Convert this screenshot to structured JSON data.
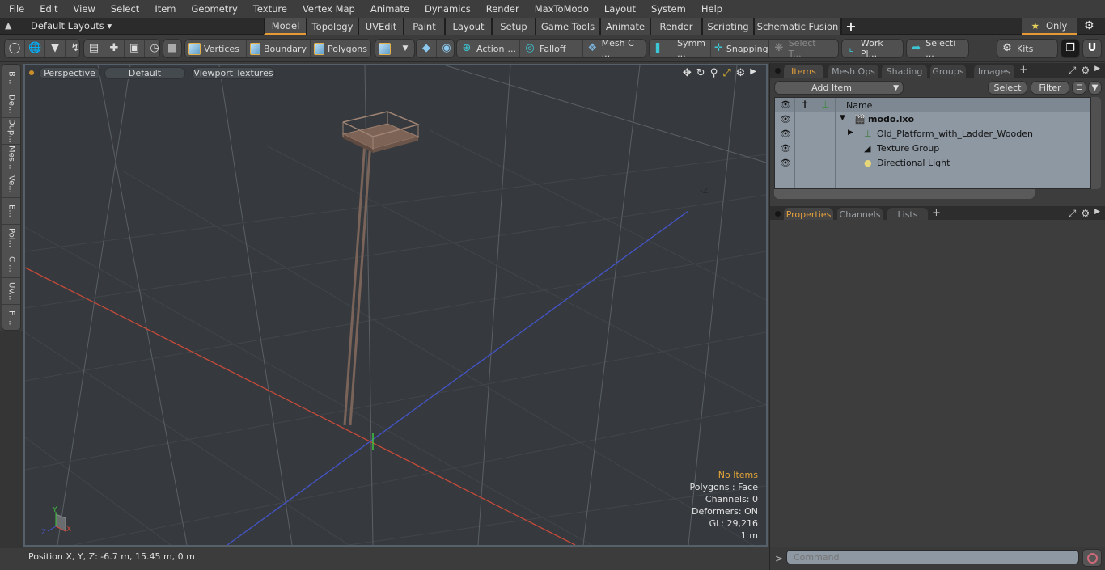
{
  "menu": [
    "File",
    "Edit",
    "View",
    "Select",
    "Item",
    "Geometry",
    "Texture",
    "Vertex Map",
    "Animate",
    "Dynamics",
    "Render",
    "MaxToModo",
    "Layout",
    "System",
    "Help"
  ],
  "layoutbar": {
    "layouts_label": "Default Layouts",
    "tabs": [
      {
        "label": "Model",
        "active": true
      },
      {
        "label": "Topology"
      },
      {
        "label": "UVEdit"
      },
      {
        "label": "Paint"
      },
      {
        "label": "Layout"
      },
      {
        "label": "Setup"
      },
      {
        "label": "Game Tools"
      },
      {
        "label": "Animate"
      },
      {
        "label": "Render"
      },
      {
        "label": "Scripting"
      },
      {
        "label": "Schematic Fusion"
      }
    ],
    "only_label": "Only"
  },
  "toolbar": {
    "vertices": "Vertices",
    "boundary": "Boundary",
    "polygons": "Polygons",
    "action": "Action",
    "falloff": "Falloff",
    "mesh_c": "Mesh C ...",
    "symm": "Symm ...",
    "snapping": "Snapping",
    "select_t": "Select T...",
    "work_pl": "Work Pl...",
    "selecti": "Selecti ...",
    "kits": "Kits",
    "ellipsis": "..."
  },
  "left_tools": [
    "B...",
    "De...",
    "Dup...",
    "Mes...",
    "Ve...",
    "E...",
    "Pol...",
    "C ...",
    "UV...",
    "F ..."
  ],
  "viewport": {
    "view_mode": "Perspective",
    "shading": "Default",
    "textures": "Viewport Textures",
    "axis_label": "-Z",
    "info": {
      "selection": "No Items",
      "polygons": "Polygons : Face",
      "channels": "Channels: 0",
      "deformers": "Deformers: ON",
      "gl": "GL: 29,216",
      "scale": "1 m"
    },
    "gizmo": {
      "x": "X",
      "y": "Y",
      "z": "Z"
    }
  },
  "status": {
    "position": "Position X, Y, Z:   -6.7 m, 15.45 m, 0 m"
  },
  "items_panel": {
    "tabs": [
      {
        "label": "Items",
        "active": true
      },
      {
        "label": "Mesh Ops"
      },
      {
        "label": "Shading"
      },
      {
        "label": "Groups"
      },
      {
        "label": "Images"
      }
    ],
    "add_item": "Add Item",
    "select": "Select",
    "filter": "Filter",
    "name_header": "Name",
    "rows": [
      {
        "name": "modo.lxo",
        "bold": true
      },
      {
        "name": "Old_Platform_with_Ladder_Wooden"
      },
      {
        "name": "Texture Group"
      },
      {
        "name": "Directional Light"
      }
    ]
  },
  "props_panel": {
    "tabs": [
      {
        "label": "Properties",
        "active": true
      },
      {
        "label": "Channels"
      },
      {
        "label": "Lists"
      }
    ]
  },
  "command": {
    "placeholder": "Command"
  },
  "colors": {
    "accent": "#e59a35",
    "x_axis": "#d2503c",
    "z_axis": "#4a5ed0",
    "y_axis": "#3fc43f",
    "model": "#8a6a5a"
  }
}
